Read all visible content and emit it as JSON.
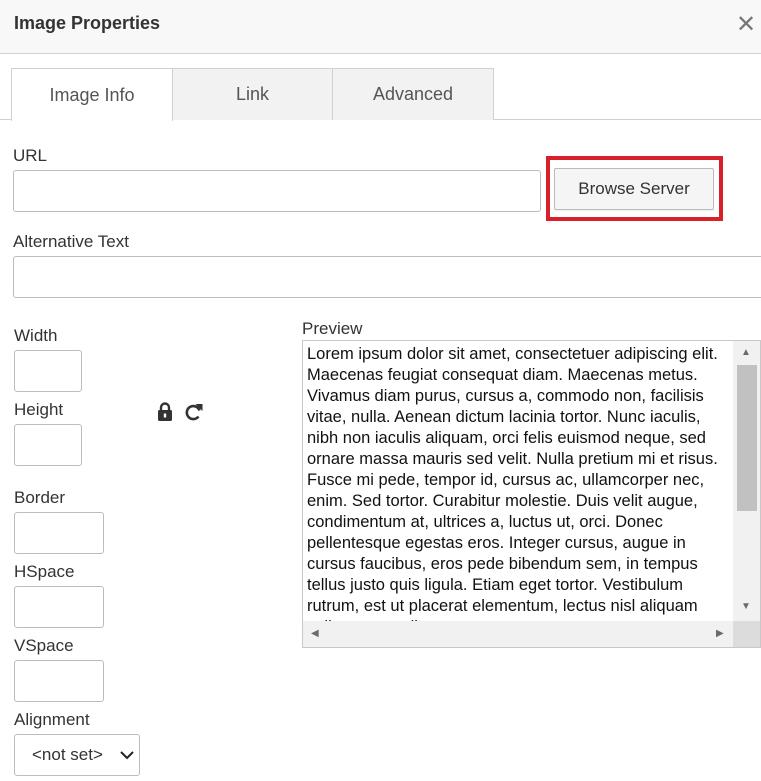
{
  "dialog": {
    "title": "Image Properties",
    "close_glyph": "✕"
  },
  "tabs": [
    {
      "label": "Image Info",
      "active": true
    },
    {
      "label": "Link",
      "active": false
    },
    {
      "label": "Advanced",
      "active": false
    }
  ],
  "form": {
    "url_label": "URL",
    "url_value": "",
    "browse_button": "Browse Server",
    "alt_label": "Alternative Text",
    "alt_value": "",
    "width_label": "Width",
    "width_value": "",
    "height_label": "Height",
    "height_value": "",
    "border_label": "Border",
    "border_value": "",
    "hspace_label": "HSpace",
    "hspace_value": "",
    "vspace_label": "VSpace",
    "vspace_value": "",
    "alignment_label": "Alignment",
    "alignment_value": "<not set>",
    "lock_icon": "lock-icon",
    "reset_icon": "reset-size-icon"
  },
  "preview": {
    "label": "Preview",
    "text": "Lorem ipsum dolor sit amet, consectetuer adipiscing elit. Maecenas feugiat consequat diam. Maecenas metus. Vivamus diam purus, cursus a, commodo non, facilisis vitae, nulla. Aenean dictum lacinia tortor. Nunc iaculis, nibh non iaculis aliquam, orci felis euismod neque, sed ornare massa mauris sed velit. Nulla pretium mi et risus. Fusce mi pede, tempor id, cursus ac, ullamcorper nec, enim. Sed tortor. Curabitur molestie. Duis velit augue, condimentum at, ultrices a, luctus ut, orci. Donec pellentesque egestas eros. Integer cursus, augue in cursus faucibus, eros pede bibendum sem, in tempus tellus justo quis ligula. Etiam eget tortor. Vestibulum rutrum, est ut placerat elementum, lectus nisl aliquam velit, tempor aliquam eros nunc nonummy metus."
  },
  "colors": {
    "highlight": "#d7202a",
    "border": "#d1d1d1"
  }
}
